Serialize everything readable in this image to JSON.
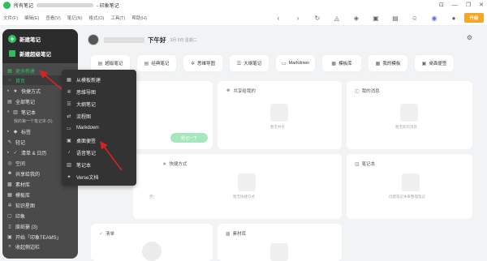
{
  "window": {
    "title_prefix": "所有笔记",
    "title_suffix": "- 印象笔记",
    "controls": [
      "⊡",
      "—",
      "❐",
      "✕"
    ]
  },
  "menubar": {
    "items": [
      "文件(F)",
      "编辑(E)",
      "查看(V)",
      "笔记(N)",
      "格式(O)",
      "工具(T)",
      "帮助(H)"
    ],
    "upgrade_label": "升级"
  },
  "sidebar": {
    "new_note": "新建笔记",
    "new_super_note": "新建超级笔记",
    "items": [
      {
        "label": "更多新建",
        "icon": "grid-icon"
      },
      {
        "label": "首页",
        "icon": "home-icon"
      },
      {
        "label": "快捷方式",
        "icon": "star-icon"
      },
      {
        "label": "全部笔记",
        "icon": "note-icon"
      },
      {
        "label": "笔记本",
        "icon": "notebook-icon"
      },
      {
        "label": "我的第一个笔记本 (5)",
        "icon": "none"
      },
      {
        "label": "标签",
        "icon": "tag-icon"
      },
      {
        "label": "轻记",
        "icon": "pen-icon"
      },
      {
        "label": "清单 & 日历",
        "icon": "check-icon"
      },
      {
        "label": "空间",
        "icon": "space-icon"
      },
      {
        "label": "共享给我的",
        "icon": "people-icon"
      },
      {
        "label": "素材库",
        "icon": "library-icon"
      },
      {
        "label": "模板库",
        "icon": "template-icon"
      },
      {
        "label": "知识星图",
        "icon": "map-icon"
      },
      {
        "label": "印象",
        "icon": "impression-icon"
      },
      {
        "label": "废纸篓 (3)",
        "icon": "trash-icon"
      },
      {
        "label": "开始「印象TEAMS」",
        "icon": "team-icon"
      },
      {
        "label": "收起侧边栏",
        "icon": "collapse-icon"
      }
    ]
  },
  "popup": {
    "items": [
      {
        "label": "从模板新建",
        "icon": "template-icon"
      },
      {
        "label": "思维导图",
        "icon": "mindmap-icon"
      },
      {
        "label": "大纲笔记",
        "icon": "outline-icon"
      },
      {
        "label": "流程图",
        "icon": "flowchart-icon"
      },
      {
        "label": "Markdown",
        "icon": "markdown-icon"
      },
      {
        "label": "桌面便签",
        "icon": "sticky-icon"
      },
      {
        "label": "语音笔记",
        "icon": "mic-icon"
      },
      {
        "label": "笔记本",
        "icon": "notebook-icon"
      },
      {
        "label": "Verse文档",
        "icon": "verse-icon"
      }
    ]
  },
  "main": {
    "greeting": "下午好",
    "date": "3月 9日 星期二",
    "quick_actions": [
      {
        "label": "超级笔记",
        "icon": "note-icon"
      },
      {
        "label": "经典笔记",
        "icon": "note-icon"
      },
      {
        "label": "思维导图",
        "icon": "mindmap-icon"
      },
      {
        "label": "大纲笔记",
        "icon": "outline-icon"
      },
      {
        "label": "Markdown",
        "icon": "markdown-icon"
      },
      {
        "label": "模板库",
        "icon": "template-icon"
      },
      {
        "label": "我的模板",
        "icon": "template-icon"
      },
      {
        "label": "桌面便签",
        "icon": "sticky-icon"
      }
    ],
    "cards": {
      "shared": {
        "title": "共享给我的",
        "empty": "暂无共享"
      },
      "messages": {
        "title": "我的消息",
        "empty": "暂无新的消息"
      },
      "shortcuts": {
        "title": "快捷方式",
        "empty": "暂无快捷方式"
      },
      "notebooks": {
        "title": "笔记本",
        "empty": "创建笔记本来整理笔记"
      },
      "checklist": {
        "title": "清单"
      },
      "library": {
        "title": "素材库"
      },
      "left_top": {
        "pill": "轻记一下"
      },
      "left_mid": {
        "empty": "完全是空白的"
      }
    }
  }
}
